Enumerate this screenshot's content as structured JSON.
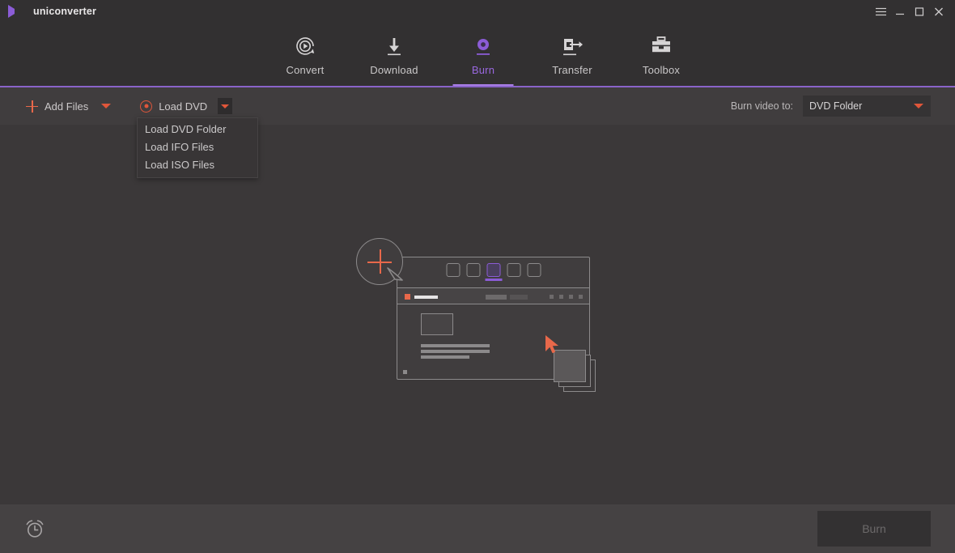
{
  "titlebar": {
    "app_name": "uniconverter",
    "logo_icon": "play-triangle-logo",
    "controls": [
      {
        "name": "menu-icon",
        "label": "☰"
      },
      {
        "name": "minimize-icon",
        "label": "—"
      },
      {
        "name": "maximize-icon",
        "label": "□"
      },
      {
        "name": "close-icon",
        "label": "✕"
      }
    ]
  },
  "nav": {
    "active": "Burn",
    "tabs": [
      {
        "label": "Convert",
        "icon": "convert-circular-play-icon"
      },
      {
        "label": "Download",
        "icon": "download-arrow-icon"
      },
      {
        "label": "Burn",
        "icon": "burn-disc-icon"
      },
      {
        "label": "Transfer",
        "icon": "transfer-device-arrow-icon"
      },
      {
        "label": "Toolbox",
        "icon": "toolbox-icon"
      }
    ],
    "accent_color": "#9a68e0",
    "underline_color": "#a87ee6",
    "baseline_color": "#8a63c9"
  },
  "toolbar": {
    "add_files_label": "Add Files",
    "add_files_icon": "plus-icon",
    "add_files_caret_icon": "caret-down-icon",
    "load_dvd_label": "Load DVD",
    "load_dvd_icon": "disc-icon",
    "load_dvd_caret_icon": "caret-down-icon",
    "burn_video_to_label": "Burn video to:",
    "output_select_value": "DVD Folder",
    "output_select_caret_icon": "caret-down-icon",
    "accent_color": "#e0563a"
  },
  "dropdown": {
    "open": true,
    "items": [
      {
        "label": "Load DVD Folder"
      },
      {
        "label": "Load IFO Files"
      },
      {
        "label": "Load ISO Files"
      }
    ]
  },
  "content": {
    "illustration": {
      "name": "drop-files-placeholder-illustration",
      "plus_icon": "plus-in-bubble-icon",
      "cursor_icon": "mouse-pointer-icon",
      "file_stack_icon": "file-stack-icon",
      "accent_color": "#e8684a",
      "highlight_color": "#8b5cd6",
      "nav_square_count": 5,
      "selected_nav_square_index": 2,
      "toolbar_dot_count": 4,
      "text_line_count": 3
    }
  },
  "bottombar": {
    "clock_icon": "alarm-clock-icon",
    "burn_button_label": "Burn",
    "burn_button_enabled": false
  },
  "colors": {
    "window_bg": "#3b3839",
    "titlebar_bg": "#323031",
    "toolbar_bg": "#403d3e",
    "bottombar_bg": "#454243",
    "purple": "#8b5cd6",
    "orange": "#e0563a"
  }
}
